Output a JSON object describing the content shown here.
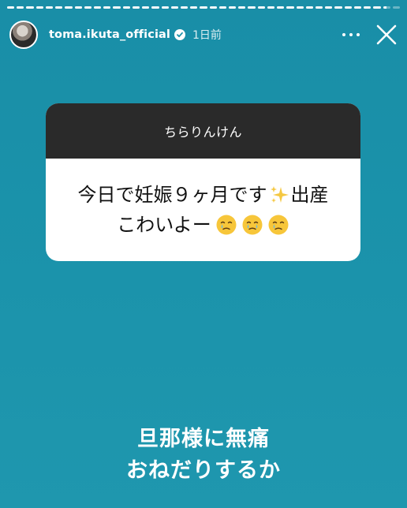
{
  "story": {
    "progress_segments": [
      1,
      1,
      1,
      1,
      1,
      1,
      1,
      1,
      1,
      1,
      1,
      1,
      1,
      1,
      1,
      1,
      1,
      1,
      1,
      1,
      1,
      1,
      1,
      1,
      1,
      1,
      1,
      1,
      1,
      1,
      1,
      1,
      1,
      1,
      1,
      1,
      1,
      1,
      1,
      0.5,
      0
    ]
  },
  "header": {
    "username": "toma.ikuta_official",
    "time": "1日前",
    "verified": true
  },
  "question": {
    "asker": "ちらりんけん",
    "line1_before": "今日で妊娠９ヶ月です",
    "line1_after": "出産",
    "line2": "こわいよー",
    "emojis": [
      "face-holding-back-tears",
      "face-holding-back-tears",
      "face-holding-back-tears"
    ]
  },
  "reply": {
    "line1": "旦那様に無痛",
    "line2": "おねだりするか"
  },
  "colors": {
    "background": "#1b91a9",
    "card_header": "#2a2a2a",
    "card_body": "#ffffff",
    "sparkle": "#f5c842",
    "emoji_face": "#f7c63a"
  }
}
